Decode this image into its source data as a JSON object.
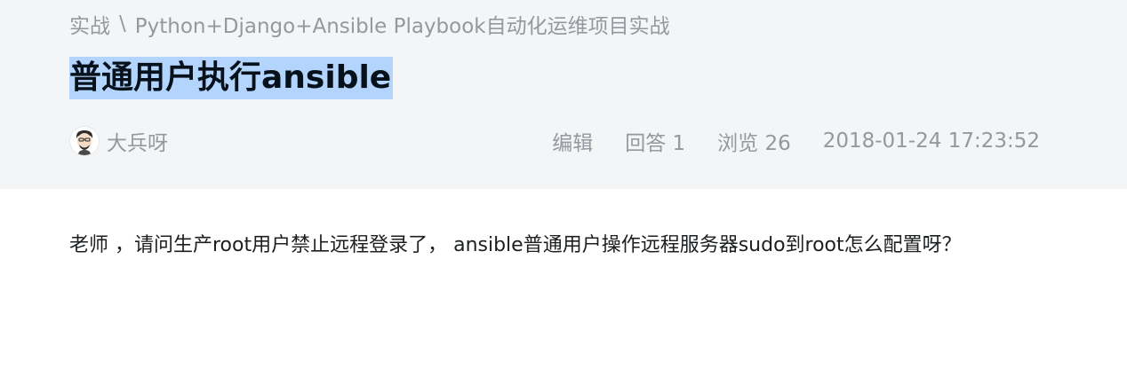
{
  "breadcrumb": {
    "items": [
      "实战",
      "Python+Django+Ansible Playbook自动化运维项目实战"
    ],
    "separator": "\\"
  },
  "question": {
    "title": "普通用户执行ansible",
    "author": {
      "name": "大兵呀",
      "avatar_icon": "avatar-cartoon-face-icon"
    },
    "edit_label": "编辑",
    "answers_text": "回答 1",
    "views_text": "浏览 26",
    "timestamp": "2018-01-24 17:23:52",
    "body": "老师 ，请问生产root用户禁止远程登录了， ansible普通用户操作远程服务器sudo到root怎么配置呀？"
  },
  "colors": {
    "header_bg": "#f3f5f7",
    "meta_text": "#93999f",
    "title_text": "#07111b",
    "selection_highlight": "#b3d4fc",
    "body_text": "#1c1f21"
  }
}
